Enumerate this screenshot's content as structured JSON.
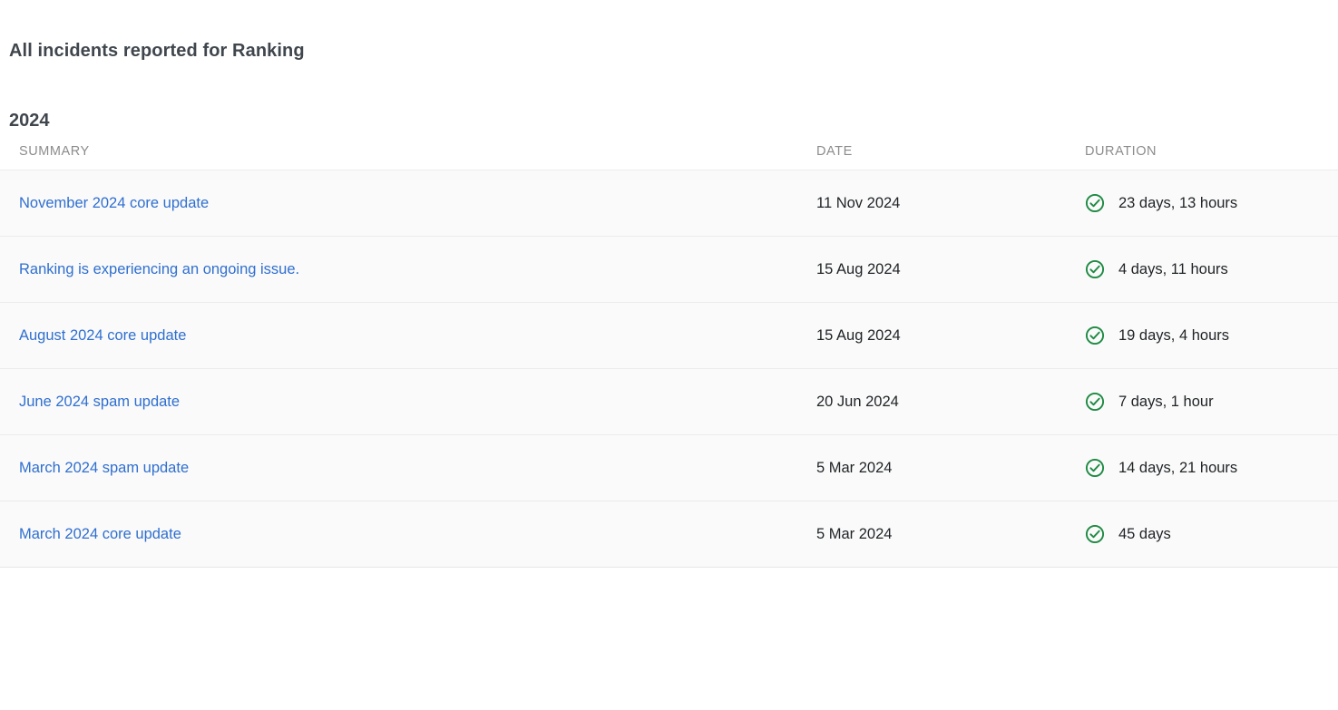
{
  "page": {
    "title": "All incidents reported for Ranking",
    "year_heading": "2024"
  },
  "colors": {
    "link": "#2f6fd0",
    "heading": "#40464d",
    "header_text": "#8c8c8c",
    "status_ok": "#1e8a43",
    "row_bg": "#fafafa",
    "row_border": "#ebebeb"
  },
  "table": {
    "headers": {
      "summary": "SUMMARY",
      "date": "DATE",
      "duration": "DURATION"
    },
    "rows": [
      {
        "summary": "November 2024 core update",
        "date": "11 Nov 2024",
        "duration": "23 days, 13 hours",
        "status_icon": "check-circle-icon"
      },
      {
        "summary": "Ranking is experiencing an ongoing issue.",
        "date": "15 Aug 2024",
        "duration": "4 days, 11 hours",
        "status_icon": "check-circle-icon"
      },
      {
        "summary": "August 2024 core update",
        "date": "15 Aug 2024",
        "duration": "19 days, 4 hours",
        "status_icon": "check-circle-icon"
      },
      {
        "summary": "June 2024 spam update",
        "date": "20 Jun 2024",
        "duration": "7 days, 1 hour",
        "status_icon": "check-circle-icon"
      },
      {
        "summary": "March 2024 spam update",
        "date": "5 Mar 2024",
        "duration": "14 days, 21 hours",
        "status_icon": "check-circle-icon"
      },
      {
        "summary": "March 2024 core update",
        "date": "5 Mar 2024",
        "duration": "45 days",
        "status_icon": "check-circle-icon"
      }
    ]
  }
}
